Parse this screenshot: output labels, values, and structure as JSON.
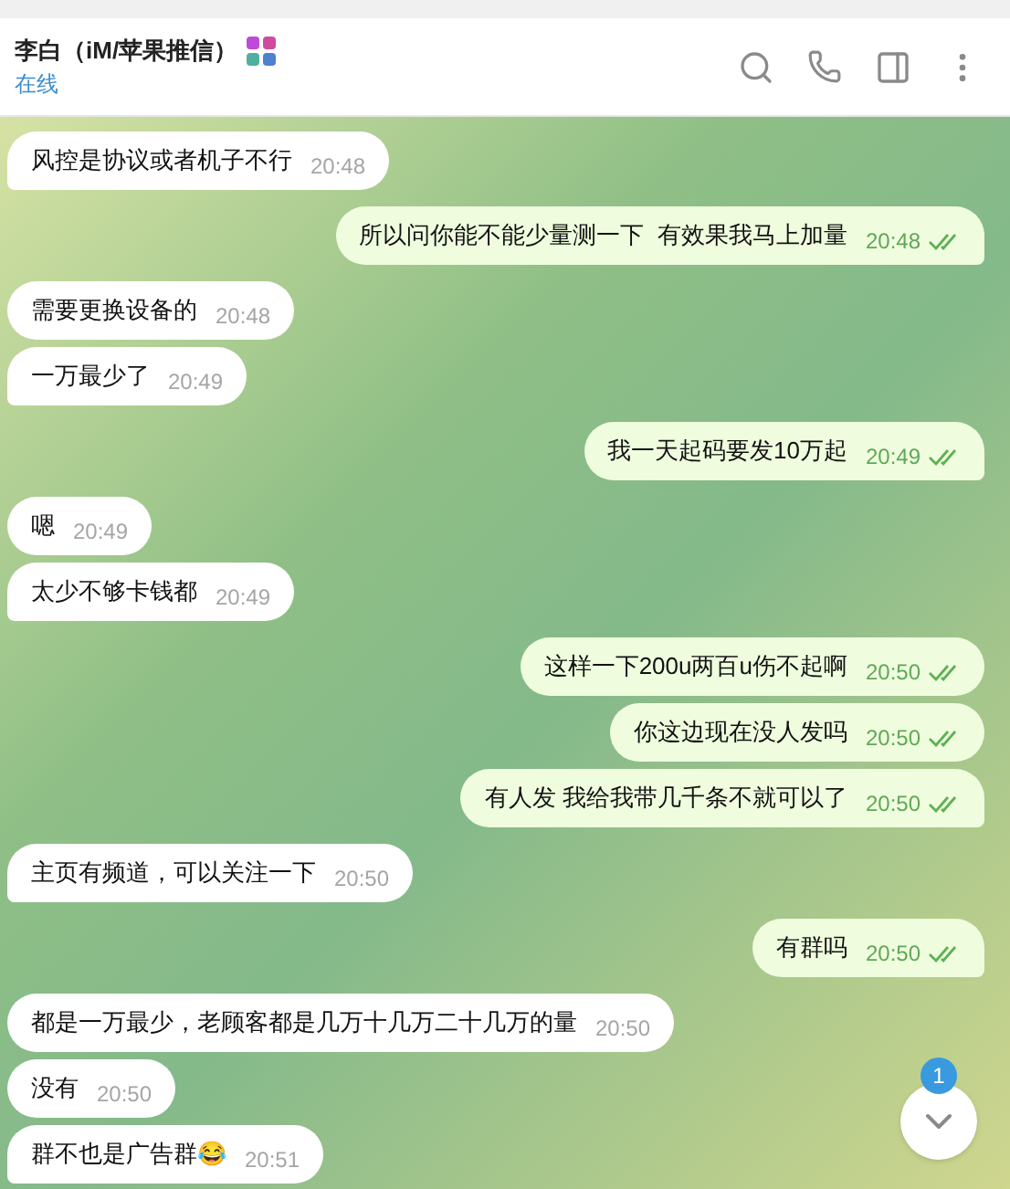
{
  "chat": {
    "title": "李白（iM/苹果推信）",
    "status": "在线"
  },
  "groups": [
    {
      "outgoing": false,
      "messages": [
        {
          "text": "风控是协议或者机子不行",
          "time": "20:48"
        }
      ]
    },
    {
      "outgoing": true,
      "messages": [
        {
          "text": "所以问你能不能少量测一下  有效果我马上加量",
          "time": "20:48",
          "read": true
        }
      ]
    },
    {
      "outgoing": false,
      "messages": [
        {
          "text": "需要更换设备的",
          "time": "20:48"
        },
        {
          "text": "一万最少了",
          "time": "20:49"
        }
      ]
    },
    {
      "outgoing": true,
      "messages": [
        {
          "text": "我一天起码要发10万起",
          "time": "20:49",
          "read": true
        }
      ]
    },
    {
      "outgoing": false,
      "messages": [
        {
          "text": "嗯",
          "time": "20:49"
        },
        {
          "text": "太少不够卡钱都",
          "time": "20:49"
        }
      ]
    },
    {
      "outgoing": true,
      "messages": [
        {
          "text": "这样一下200u两百u伤不起啊",
          "time": "20:50",
          "read": true
        },
        {
          "text": "你这边现在没人发吗",
          "time": "20:50",
          "read": true
        },
        {
          "text": "有人发 我给我带几千条不就可以了",
          "time": "20:50",
          "read": true
        }
      ]
    },
    {
      "outgoing": false,
      "messages": [
        {
          "text": "主页有频道，可以关注一下",
          "time": "20:50"
        }
      ]
    },
    {
      "outgoing": true,
      "messages": [
        {
          "text": "有群吗",
          "time": "20:50",
          "read": true
        }
      ]
    },
    {
      "outgoing": false,
      "messages": [
        {
          "text": "都是一万最少，老顾客都是几万十几万二十几万的量",
          "time": "20:50"
        },
        {
          "text": "没有",
          "time": "20:50"
        },
        {
          "text": "群不也是广告群😂",
          "time": "20:51"
        }
      ]
    }
  ],
  "scroll_button": {
    "badge": "1"
  }
}
